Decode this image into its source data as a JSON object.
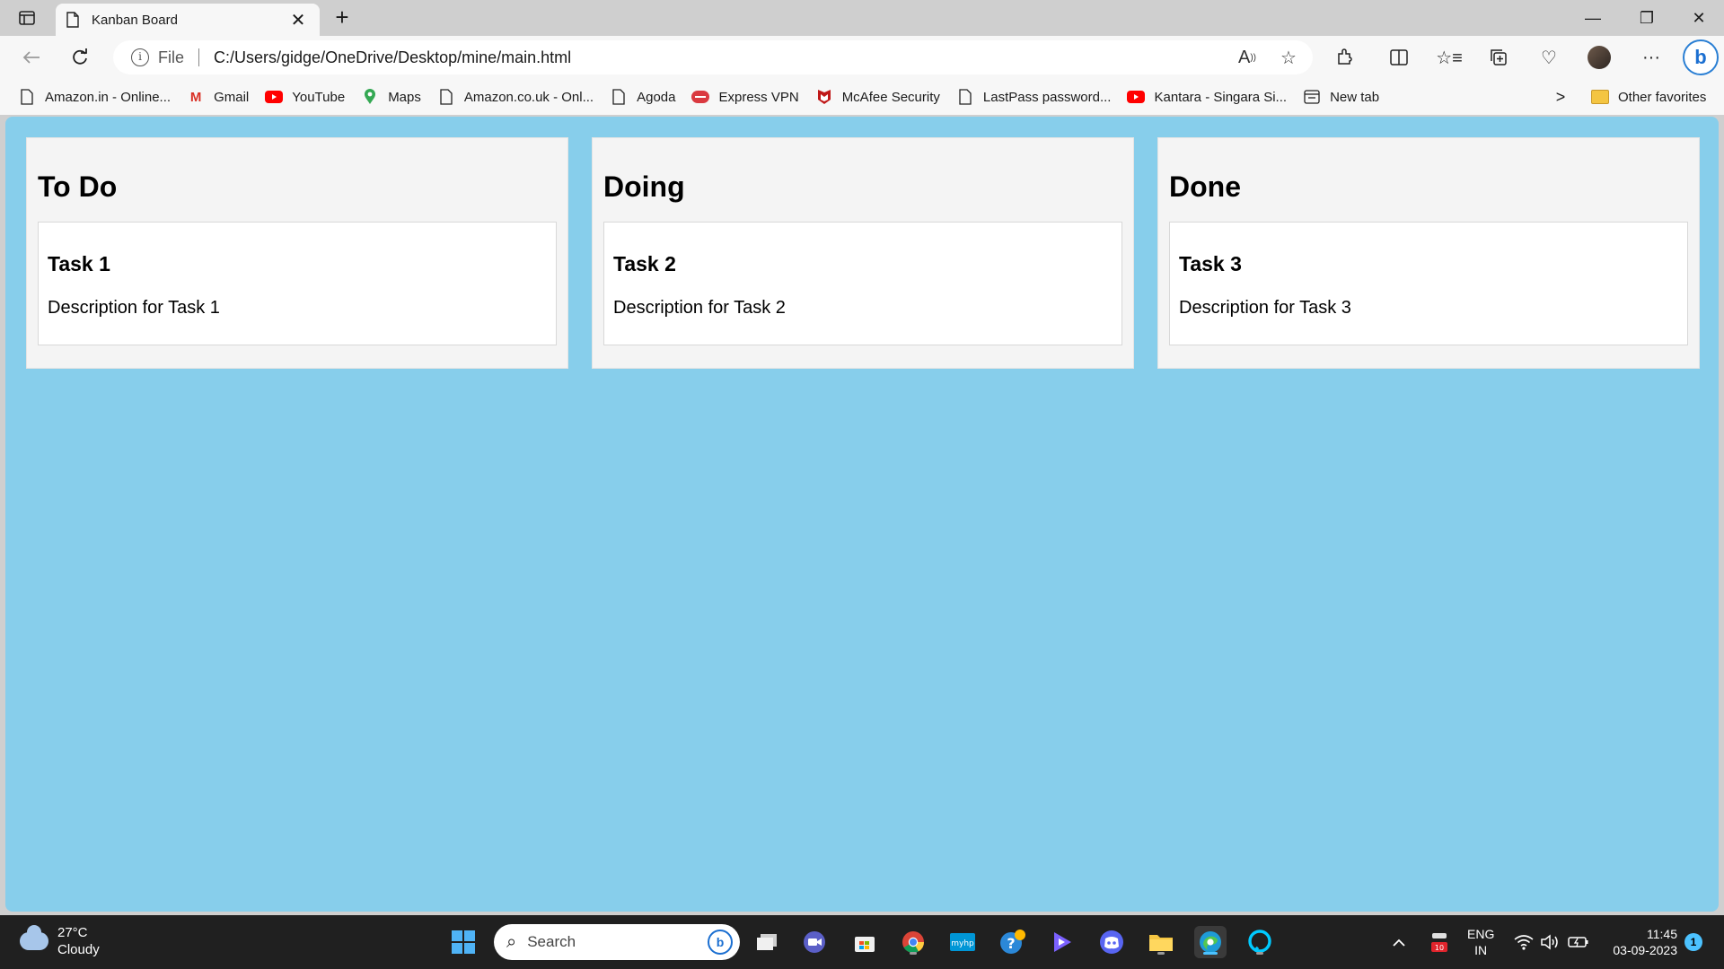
{
  "browser": {
    "tab": {
      "title": "Kanban Board",
      "close": "✕"
    },
    "new_tab": "+",
    "window_controls": {
      "minimize": "—",
      "restore": "❐",
      "close": "✕"
    },
    "address": {
      "scheme": "File",
      "url": "C:/Users/gidge/OneDrive/Desktop/mine/main.html"
    },
    "bing_label": "b"
  },
  "favorites": {
    "items": [
      {
        "label": "Amazon.in - Online...",
        "icon": "page-icon"
      },
      {
        "label": "Gmail",
        "icon": "gmail-icon"
      },
      {
        "label": "YouTube",
        "icon": "youtube-icon"
      },
      {
        "label": "Maps",
        "icon": "maps-pin-icon"
      },
      {
        "label": "Amazon.co.uk - Onl...",
        "icon": "page-icon"
      },
      {
        "label": "Agoda",
        "icon": "page-icon"
      },
      {
        "label": "Express VPN",
        "icon": "expressvpn-icon"
      },
      {
        "label": "McAfee Security",
        "icon": "mcafee-icon"
      },
      {
        "label": "LastPass password...",
        "icon": "page-icon"
      },
      {
        "label": "Kantara - Singara Si...",
        "icon": "youtube-icon"
      },
      {
        "label": "New tab",
        "icon": "newtab-icon"
      }
    ],
    "other": "Other favorites"
  },
  "board": {
    "background": "#87ceeb",
    "columns": [
      {
        "title": "To Do",
        "cards": [
          {
            "title": "Task 1",
            "description": "Description for Task 1"
          }
        ]
      },
      {
        "title": "Doing",
        "cards": [
          {
            "title": "Task 2",
            "description": "Description for Task 2"
          }
        ]
      },
      {
        "title": "Done",
        "cards": [
          {
            "title": "Task 3",
            "description": "Description for Task 3"
          }
        ]
      }
    ]
  },
  "taskbar": {
    "weather": {
      "temp": "27°C",
      "condition": "Cloudy"
    },
    "search_placeholder": "Search",
    "language": {
      "line1": "ENG",
      "line2": "IN"
    },
    "clock": {
      "time": "11:45",
      "date": "03-09-2023"
    },
    "notifications": "1",
    "tray_badge": "10"
  }
}
